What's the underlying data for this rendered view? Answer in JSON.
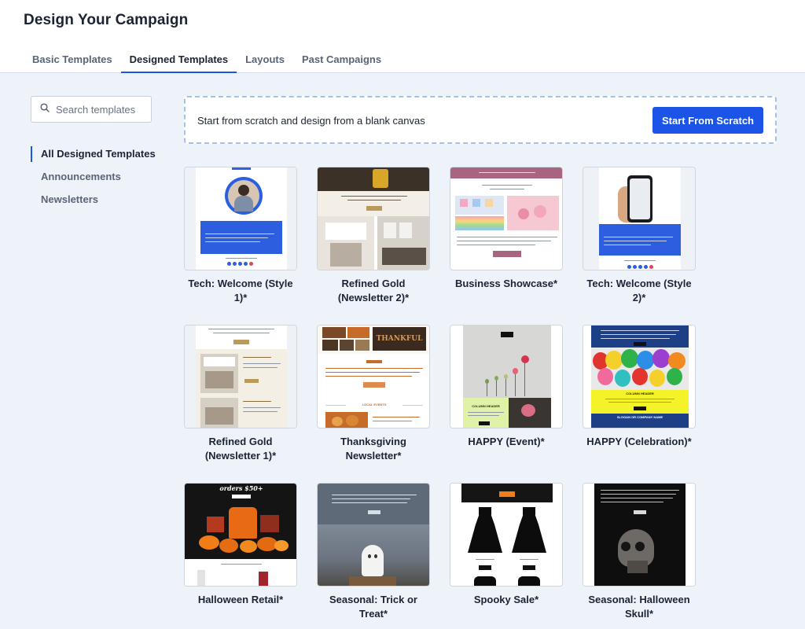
{
  "header": {
    "title": "Design Your Campaign",
    "tabs": [
      {
        "label": "Basic Templates"
      },
      {
        "label": "Designed Templates"
      },
      {
        "label": "Layouts"
      },
      {
        "label": "Past Campaigns"
      }
    ]
  },
  "sidebar": {
    "search_placeholder": "Search templates",
    "items": [
      {
        "label": "All Designed Templates"
      },
      {
        "label": "Announcements"
      },
      {
        "label": "Newsletters"
      }
    ]
  },
  "scratch": {
    "text": "Start from scratch and design from a blank canvas",
    "button": "Start From Scratch"
  },
  "templates": [
    {
      "name": "Tech: Welcome (Style 1)*"
    },
    {
      "name": "Refined Gold (Newsletter 2)*"
    },
    {
      "name": "Business Showcase*"
    },
    {
      "name": "Tech: Welcome (Style 2)*"
    },
    {
      "name": "Refined Gold (Newsletter 1)*"
    },
    {
      "name": "Thanksgiving Newsletter*"
    },
    {
      "name": "HAPPY (Event)*"
    },
    {
      "name": "HAPPY (Celebration)*"
    },
    {
      "name": "Halloween Retail*"
    },
    {
      "name": "Seasonal: Trick or Treat*"
    },
    {
      "name": "Spooky Sale*"
    },
    {
      "name": "Seasonal: Halloween Skull*"
    }
  ],
  "thumb_text": {
    "column_header": "COLUMN HEADER",
    "slogan": "SLOGAN OR COMPANY NAME",
    "orders": "orders $50+",
    "thankful": "THANKFUL",
    "local_events": "LOCAL EVENTS"
  },
  "colors": {
    "accent": "#1d54e8",
    "page_bg": "#eef2f9",
    "card_border": "#cfd6e2"
  }
}
